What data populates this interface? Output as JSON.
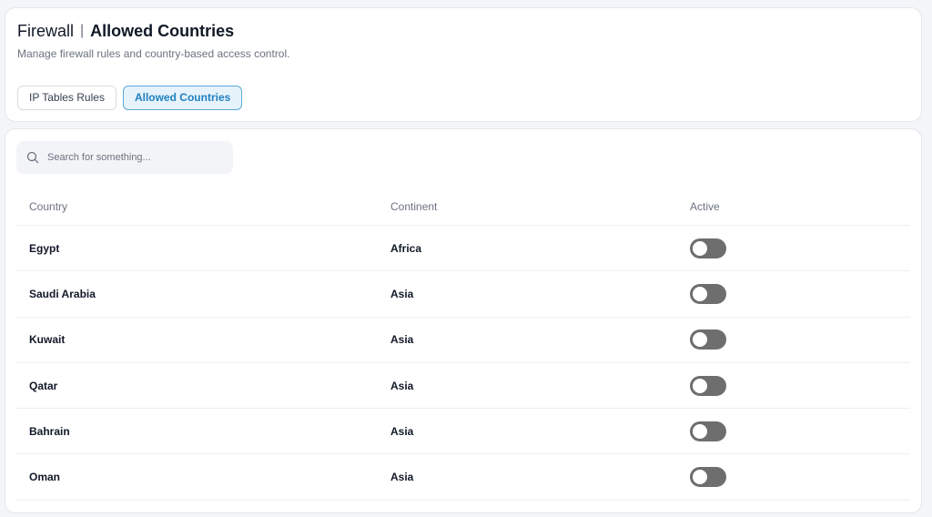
{
  "header": {
    "title_prefix": "Firewall",
    "title_separator": "|",
    "title_main": "Allowed Countries",
    "subtitle": "Manage firewall rules and country-based access control."
  },
  "tabs": [
    {
      "label": "IP Tables Rules",
      "active": false
    },
    {
      "label": "Allowed Countries",
      "active": true
    }
  ],
  "search": {
    "placeholder": "Search for something...",
    "value": "",
    "icon": "search-icon"
  },
  "table": {
    "columns": [
      "Country",
      "Continent",
      "Active"
    ],
    "rows": [
      {
        "country": "Egypt",
        "continent": "Africa",
        "active": false
      },
      {
        "country": "Saudi Arabia",
        "continent": "Asia",
        "active": false
      },
      {
        "country": "Kuwait",
        "continent": "Asia",
        "active": false
      },
      {
        "country": "Qatar",
        "continent": "Asia",
        "active": false
      },
      {
        "country": "Bahrain",
        "continent": "Asia",
        "active": false
      },
      {
        "country": "Oman",
        "continent": "Asia",
        "active": false
      }
    ]
  },
  "colors": {
    "accent": "#1f7fc1",
    "tab_active_bg": "#e6f3fb",
    "toggle_off": "#6e6e6e"
  }
}
